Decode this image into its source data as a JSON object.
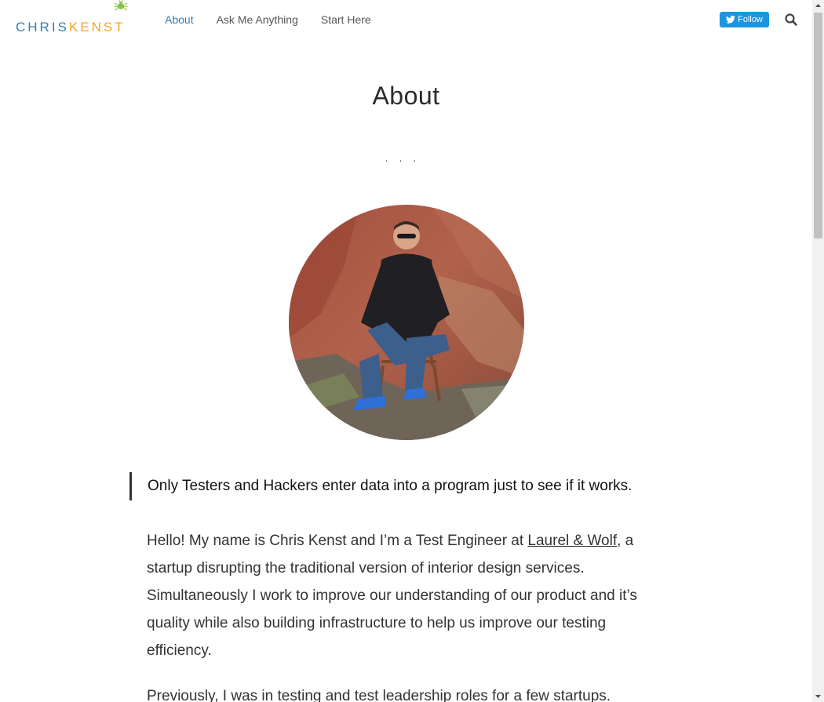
{
  "header": {
    "logo": {
      "part1": "CHRIS",
      "part2": "KENST"
    },
    "nav": [
      {
        "label": "About",
        "active": true
      },
      {
        "label": "Ask Me Anything",
        "active": false
      },
      {
        "label": "Start Here",
        "active": false
      }
    ],
    "follow_label": "Follow",
    "search_icon": "search-icon"
  },
  "main": {
    "title": "About",
    "separator": "...",
    "quote": "Only Testers and Hackers enter data into a program just to see if it works.",
    "paragraph1": {
      "before": "Hello! My name is Chris Kenst and I’m a Test Engineer at ",
      "link": "Laurel & Wolf",
      "after": ", a startup disrupting the traditional version of interior design services. Simultaneously I work to improve our understanding of our product and it’s quality while also building infrastructure to help us improve our testing efficiency."
    },
    "paragraph2": "Previously, I was in testing and test leadership roles for a few startups."
  },
  "colors": {
    "accent": "#2f7fb8",
    "logo_orange": "#f5a523",
    "twitter_blue": "#1b95e0",
    "text": "#333333"
  }
}
